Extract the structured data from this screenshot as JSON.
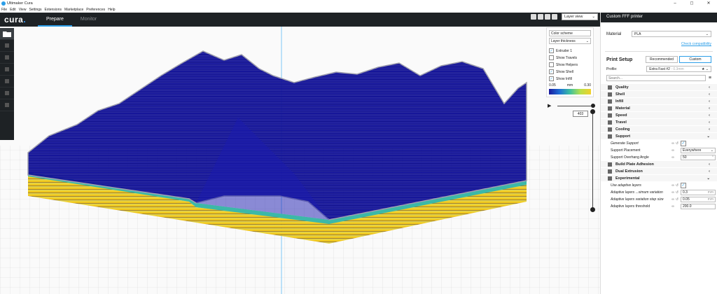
{
  "window": {
    "title": "Ultimaker Cura",
    "controls": [
      "–",
      "◻",
      "✕"
    ]
  },
  "menu": [
    "File",
    "Edit",
    "View",
    "Settings",
    "Extensions",
    "Marketplace",
    "Preferences",
    "Help"
  ],
  "header": {
    "logo_text": "cura",
    "logo_dot": ".",
    "tabs": [
      {
        "label": "Prepare"
      },
      {
        "label": "Monitor"
      }
    ]
  },
  "view": {
    "selected": "Layer view"
  },
  "layer_panel": {
    "color_scheme_label": "Color scheme",
    "color_scheme_value": "Layer thickness",
    "checks": [
      {
        "label": "Extruder 1",
        "checked": "✓"
      },
      {
        "label": "Show Travels",
        "checked": ""
      },
      {
        "label": "Show Helpers",
        "checked": ""
      },
      {
        "label": "Show Shell",
        "checked": "✓"
      },
      {
        "label": "Show Infill",
        "checked": "✓"
      }
    ],
    "range_min": "0.05",
    "range_unit": "mm",
    "range_max": "0.30"
  },
  "layer_slider": {
    "value": "403"
  },
  "sidebar": {
    "printer": "Custom FFF printer",
    "material_label": "Material",
    "material_value": "PLA",
    "check_compat": "Check compatibility",
    "print_setup": "Print Setup",
    "mode_recommended": "Recommended",
    "mode_custom": "Custom",
    "profile_label": "Profile:",
    "profile_value": "Extra Fast  #2",
    "profile_suffix": "- 0.3mm",
    "search_placeholder": "Search...",
    "categories": [
      {
        "label": "Quality"
      },
      {
        "label": "Shell"
      },
      {
        "label": "Infill"
      },
      {
        "label": "Material"
      },
      {
        "label": "Speed"
      },
      {
        "label": "Travel"
      },
      {
        "label": "Cooling"
      }
    ],
    "support": {
      "label": "Support",
      "settings": [
        {
          "label": "Generate Support",
          "value": "✓"
        },
        {
          "label": "Support Placement",
          "value": "Everywhere"
        },
        {
          "label": "Support Overhang Angle",
          "value": "50",
          "unit": "°"
        }
      ]
    },
    "categories2": [
      {
        "label": "Build Plate Adhesion"
      },
      {
        "label": "Dual Extrusion"
      }
    ],
    "experimental": {
      "label": "Experimental",
      "settings": [
        {
          "label": "Use adaptive layers",
          "value": "✓"
        },
        {
          "label": "Adaptive layers ...ximum variation",
          "value": "0.3",
          "unit": "mm"
        },
        {
          "label": "Adaptive layers variation step size",
          "value": "0.05",
          "unit": "mm"
        },
        {
          "label": "Adaptive layers threshold",
          "value": "200.0",
          "unit": ""
        }
      ]
    }
  }
}
